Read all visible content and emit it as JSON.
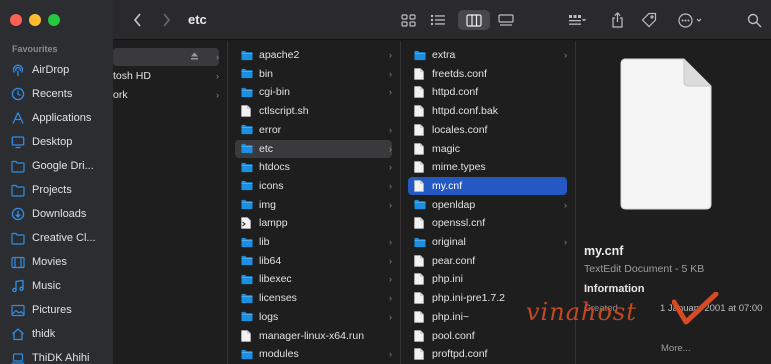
{
  "sidebar": {
    "heading": "Favourites",
    "items": [
      {
        "label": "AirDrop",
        "icon": "airdrop-icon"
      },
      {
        "label": "Recents",
        "icon": "clock-icon"
      },
      {
        "label": "Applications",
        "icon": "applications-icon"
      },
      {
        "label": "Desktop",
        "icon": "desktop-icon"
      },
      {
        "label": "Google Dri...",
        "icon": "folder-icon"
      },
      {
        "label": "Projects",
        "icon": "folder-icon"
      },
      {
        "label": "Downloads",
        "icon": "downloads-icon"
      },
      {
        "label": "Creative Cl...",
        "icon": "folder-icon"
      },
      {
        "label": "Movies",
        "icon": "movies-icon"
      },
      {
        "label": "Music",
        "icon": "music-icon"
      },
      {
        "label": "Pictures",
        "icon": "pictures-icon"
      },
      {
        "label": "thidk",
        "icon": "home-icon"
      },
      {
        "label": "ThiDK Ahihi",
        "icon": "laptop-icon"
      }
    ]
  },
  "toolbar": {
    "title": "etc",
    "back_icon": "chevron-left-icon",
    "forward_icon": "chevron-right-icon",
    "view_icons": [
      "grid-view-icon",
      "list-view-icon",
      "column-view-icon",
      "gallery-view-icon"
    ],
    "group_icon": "group-icon",
    "share_icon": "share-icon",
    "tag_icon": "tag-icon",
    "more_icon": "ellipsis-icon",
    "search_icon": "search-icon"
  },
  "columns": {
    "col1": [
      {
        "label": "",
        "eject": true
      },
      {
        "label": "tosh HD",
        "chevron": true
      },
      {
        "label": "ork",
        "chevron": true
      }
    ],
    "col2": [
      {
        "label": "apache2",
        "type": "folder"
      },
      {
        "label": "bin",
        "type": "folder"
      },
      {
        "label": "cgi-bin",
        "type": "folder"
      },
      {
        "label": "ctlscript.sh",
        "type": "file"
      },
      {
        "label": "error",
        "type": "folder"
      },
      {
        "label": "etc",
        "type": "folder",
        "highlighted": true
      },
      {
        "label": "htdocs",
        "type": "folder"
      },
      {
        "label": "icons",
        "type": "folder"
      },
      {
        "label": "img",
        "type": "folder"
      },
      {
        "label": "lampp",
        "type": "exec"
      },
      {
        "label": "lib",
        "type": "folder"
      },
      {
        "label": "lib64",
        "type": "folder"
      },
      {
        "label": "libexec",
        "type": "folder"
      },
      {
        "label": "licenses",
        "type": "folder"
      },
      {
        "label": "logs",
        "type": "folder"
      },
      {
        "label": "manager-linux-x64.run",
        "type": "file"
      },
      {
        "label": "modules",
        "type": "folder"
      }
    ],
    "col3": [
      {
        "label": "extra",
        "type": "folder"
      },
      {
        "label": "freetds.conf",
        "type": "file"
      },
      {
        "label": "httpd.conf",
        "type": "file"
      },
      {
        "label": "httpd.conf.bak",
        "type": "file"
      },
      {
        "label": "locales.conf",
        "type": "file"
      },
      {
        "label": "magic",
        "type": "file"
      },
      {
        "label": "mime.types",
        "type": "file"
      },
      {
        "label": "my.cnf",
        "type": "file",
        "selected": true
      },
      {
        "label": "openldap",
        "type": "folder"
      },
      {
        "label": "openssl.cnf",
        "type": "file"
      },
      {
        "label": "original",
        "type": "folder"
      },
      {
        "label": "pear.conf",
        "type": "file"
      },
      {
        "label": "php.ini",
        "type": "file"
      },
      {
        "label": "php.ini-pre1.7.2",
        "type": "file"
      },
      {
        "label": "php.ini~",
        "type": "file"
      },
      {
        "label": "pool.conf",
        "type": "file"
      },
      {
        "label": "proftpd.conf",
        "type": "file"
      }
    ]
  },
  "preview": {
    "name": "my.cnf",
    "kind": "TextEdit Document - 5 KB",
    "info_heading": "Information",
    "created_label": "Created",
    "created_value": "1 January 2001 at 07:00",
    "more": "More..."
  },
  "watermark": "vinahost",
  "colors": {
    "selection": "#2459c4",
    "folder": "#1b8fe0",
    "sidebar_icon": "#2f8ee6",
    "close": "#fe5f57",
    "minimize": "#febc2e",
    "zoom": "#28c840",
    "watermark": "#d64b24"
  }
}
